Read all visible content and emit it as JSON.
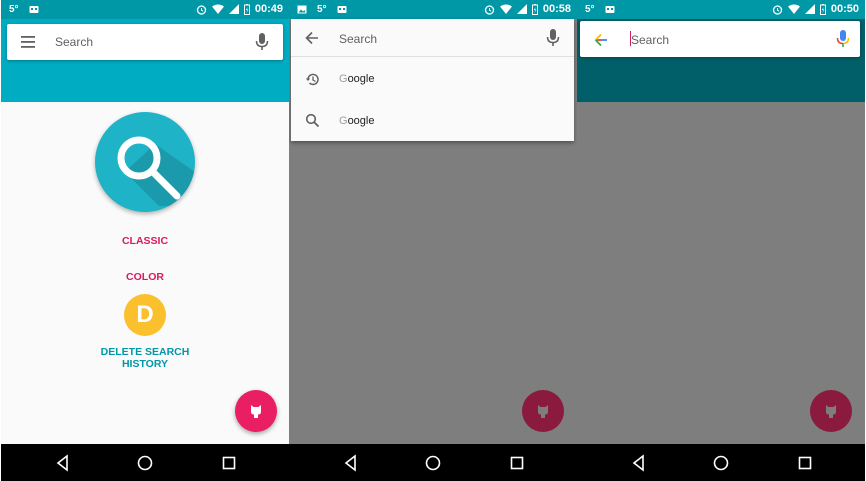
{
  "screens": [
    {
      "status": {
        "temp": "5°",
        "time": "00:49"
      },
      "search": {
        "placeholder": "Search"
      },
      "menu": {
        "classic": "CLASSIC",
        "color": "COLOR",
        "delete_badge": "D",
        "delete_line1": "DELETE SEARCH",
        "delete_line2": "HISTORY"
      },
      "colors": {
        "appbar": "#00acc1",
        "accent": "#e91e63",
        "teal_text": "#0097a7",
        "fab": "#e91e63"
      }
    },
    {
      "status": {
        "temp": "5°",
        "time": "00:58"
      },
      "search": {
        "placeholder": "Search"
      },
      "suggestions": [
        {
          "icon": "history-icon",
          "hint": "G",
          "text": "oogle"
        },
        {
          "icon": "search-icon",
          "hint": "G",
          "text": "oogle"
        }
      ],
      "colors": {
        "appbar": "#00a4b6",
        "fab": "#8a1a3e"
      }
    },
    {
      "status": {
        "temp": "5°",
        "time": "00:50"
      },
      "search": {
        "value": "Search"
      },
      "colors": {
        "appbar": "#005f68",
        "fab": "#8a1a3e"
      }
    }
  ]
}
